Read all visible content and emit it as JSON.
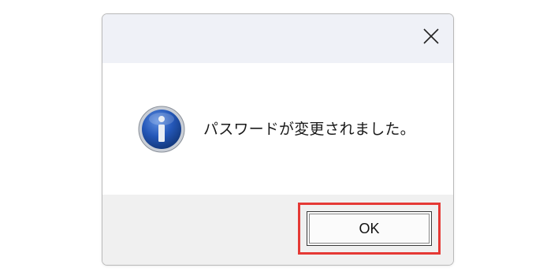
{
  "dialog": {
    "close_icon": "close-icon",
    "info_icon": "information-icon",
    "message": "パスワードが変更されました。",
    "ok_label": "OK",
    "colors": {
      "titlebar_bg": "#eff1f7",
      "footer_bg": "#f0f0f0",
      "highlight": "#e53935",
      "icon_blue": "#1f4fa8"
    }
  }
}
